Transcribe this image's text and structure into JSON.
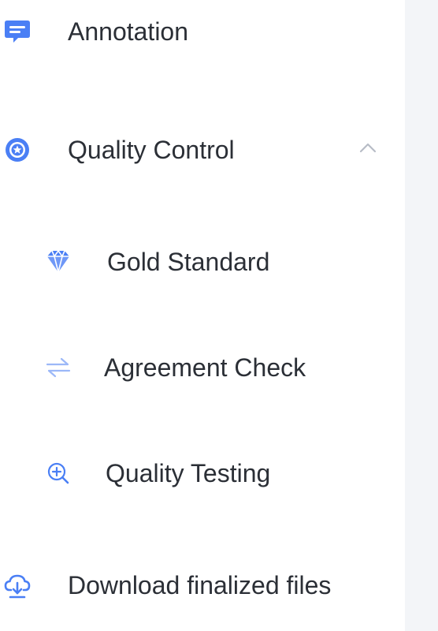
{
  "sidebar": {
    "items": [
      {
        "label": "Annotation",
        "icon": "annotation-icon"
      },
      {
        "label": "Quality Control",
        "icon": "quality-control-icon",
        "expanded": true,
        "chevron_icon": "chevron-up-icon",
        "children": [
          {
            "label": "Gold Standard",
            "icon": "diamond-icon"
          },
          {
            "label": "Agreement Check",
            "icon": "swap-arrows-icon"
          },
          {
            "label": "Quality Testing",
            "icon": "zoom-in-icon"
          }
        ]
      },
      {
        "label": "Download finalized files",
        "icon": "cloud-download-icon"
      }
    ]
  },
  "colors": {
    "accent": "#4a7ff5",
    "accent_light": "#9cb8f8",
    "text": "#2b2f36",
    "muted": "#b7bcc6",
    "panel_bg": "#f3f5f8"
  }
}
